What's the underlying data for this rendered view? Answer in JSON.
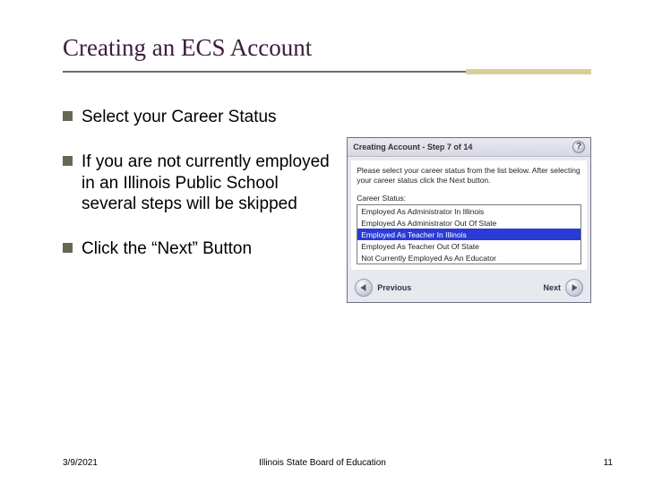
{
  "title": "Creating an ECS Account",
  "bullets": [
    "Select your Career Status",
    "If you are not currently employed in an Illinois Public School several steps will be skipped",
    "Click the “Next” Button"
  ],
  "panel": {
    "title": "Creating Account - Step 7 of 14",
    "instruction": "Please select your career status from the list below. After selecting your career status click the Next button.",
    "label": "Career Status:",
    "options": [
      "Employed As Administrator In Illinois",
      "Employed As Administrator Out Of State",
      "Employed As Teacher In Illinois",
      "Employed As Teacher Out Of State",
      "Not Currently Employed As An Educator"
    ],
    "selectedIndex": 2,
    "prev": "Previous",
    "next": "Next"
  },
  "footer": {
    "date": "3/9/2021",
    "org": "Illinois State Board of Education",
    "page": "11"
  }
}
